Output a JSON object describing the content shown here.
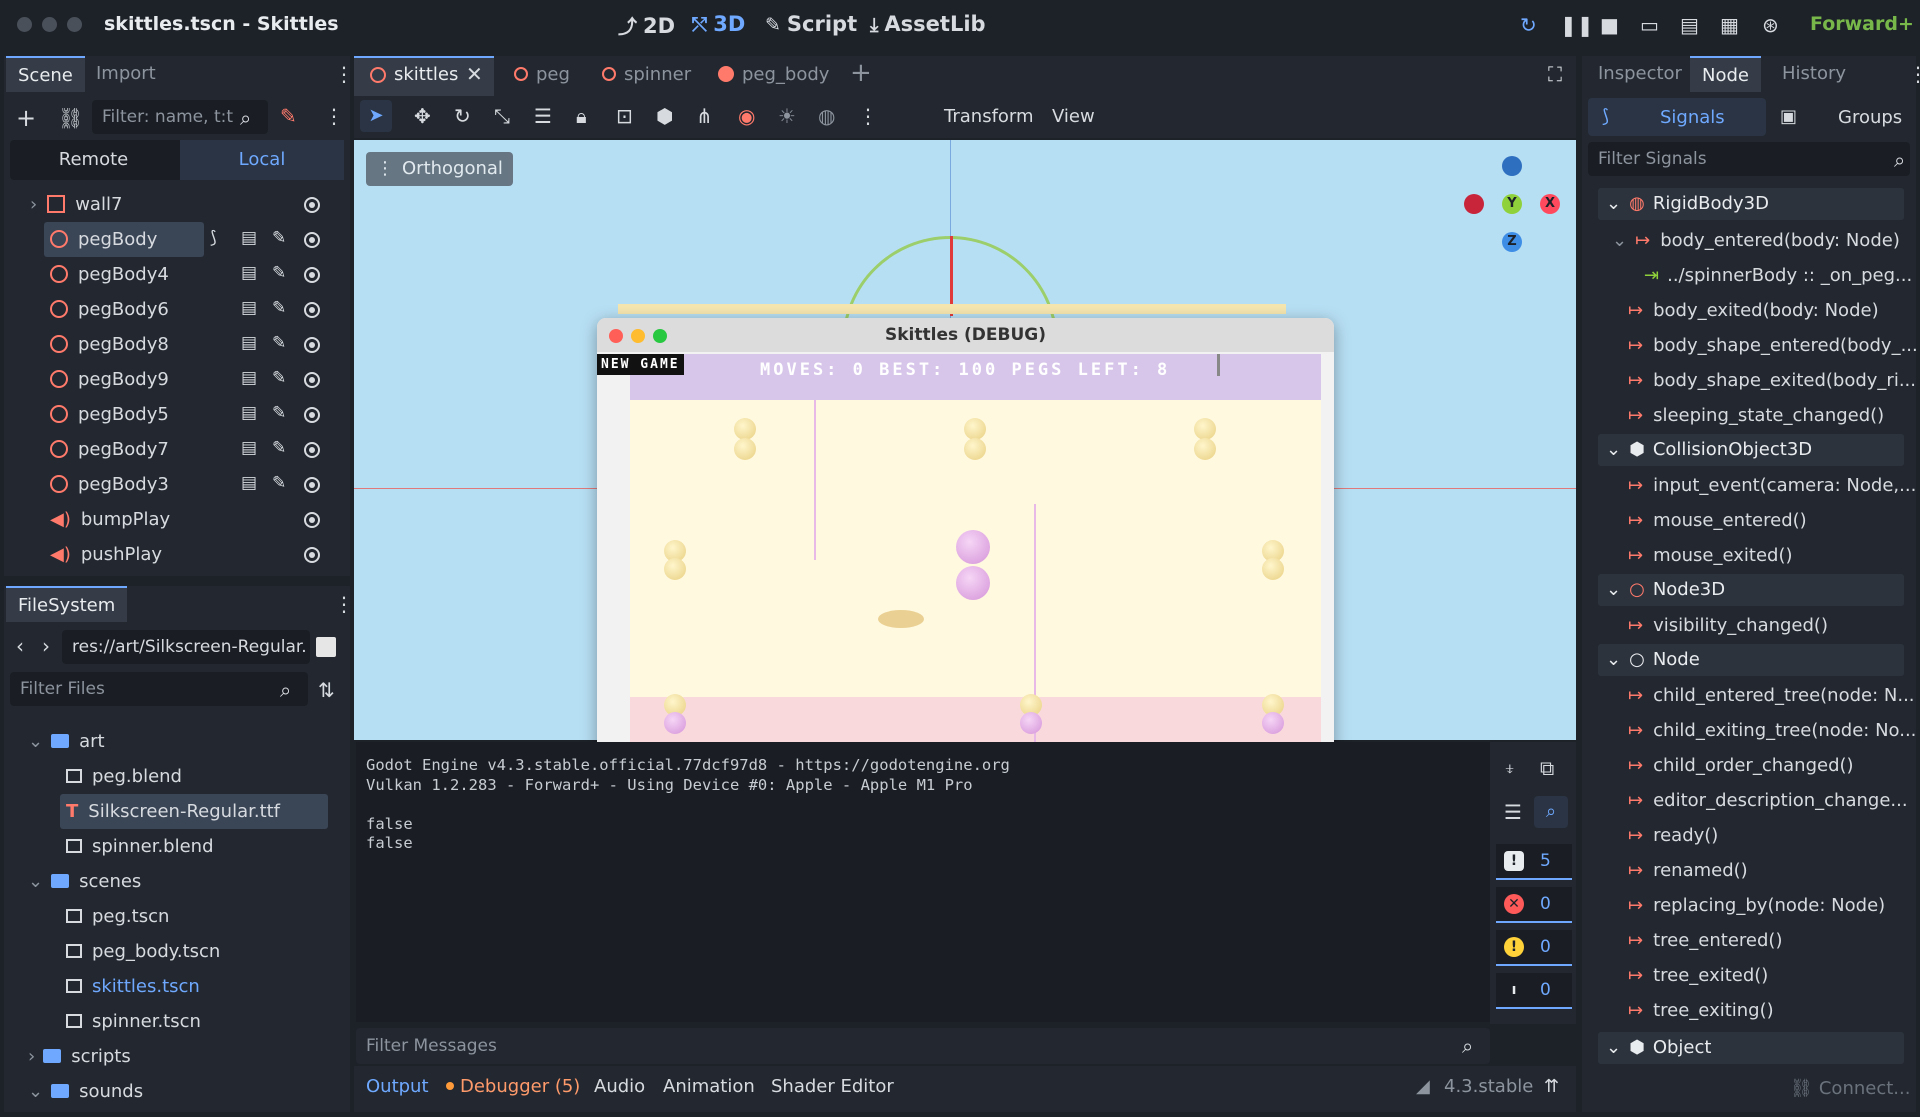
{
  "window": {
    "title": "skittles.tscn - Skittles",
    "renderer": "Forward+"
  },
  "modes": [
    {
      "label": "2D"
    },
    {
      "label": "3D"
    },
    {
      "label": "Script"
    },
    {
      "label": "AssetLib"
    }
  ],
  "scene_dock": {
    "tabs": [
      "Scene",
      "Import"
    ],
    "filter_placeholder": "Filter: name, t:t",
    "remote_label": "Remote",
    "local_label": "Local",
    "nodes": [
      {
        "name": "wall7",
        "type": "static"
      },
      {
        "name": "pegBody",
        "type": "rigid"
      },
      {
        "name": "pegBody4",
        "type": "rigid"
      },
      {
        "name": "pegBody6",
        "type": "rigid"
      },
      {
        "name": "pegBody8",
        "type": "rigid"
      },
      {
        "name": "pegBody9",
        "type": "rigid"
      },
      {
        "name": "pegBody5",
        "type": "rigid"
      },
      {
        "name": "pegBody7",
        "type": "rigid"
      },
      {
        "name": "pegBody3",
        "type": "rigid"
      },
      {
        "name": "bumpPlay",
        "type": "audio"
      },
      {
        "name": "pushPlay",
        "type": "audio"
      }
    ]
  },
  "filesystem": {
    "title": "FileSystem",
    "path": "res://art/Silkscreen-Regular.",
    "filter_placeholder": "Filter Files",
    "items": [
      {
        "name": "art",
        "kind": "folder"
      },
      {
        "name": "peg.blend",
        "kind": "file"
      },
      {
        "name": "Silkscreen-Regular.ttf",
        "kind": "font"
      },
      {
        "name": "spinner.blend",
        "kind": "file"
      },
      {
        "name": "scenes",
        "kind": "folder"
      },
      {
        "name": "peg.tscn",
        "kind": "file"
      },
      {
        "name": "peg_body.tscn",
        "kind": "file"
      },
      {
        "name": "skittles.tscn",
        "kind": "file"
      },
      {
        "name": "spinner.tscn",
        "kind": "file"
      },
      {
        "name": "scripts",
        "kind": "folder"
      },
      {
        "name": "sounds",
        "kind": "folder"
      }
    ]
  },
  "editor_tabs": [
    "skittles",
    "peg",
    "spinner",
    "peg_body"
  ],
  "viewport_toolbar": {
    "transform": "Transform",
    "view": "View",
    "projection": "Orthogonal"
  },
  "gizmo": {
    "x": "X",
    "y": "Y",
    "z": "Z"
  },
  "game_window": {
    "title": "Skittles (DEBUG)",
    "new_game": "NEW GAME",
    "hud": "MOVES: 0 BEST: 100 PEGS LEFT: 8"
  },
  "console": {
    "lines": [
      "Godot Engine v4.3.stable.official.77dcf97d8 - https://godotengine.org",
      "Vulkan 1.2.283 - Forward+ - Using Device #0: Apple - Apple M1 Pro",
      "",
      "false",
      "false"
    ],
    "filter_placeholder": "Filter Messages",
    "counts": {
      "messages": "5",
      "errors": "0",
      "warnings": "0",
      "info": "0"
    }
  },
  "bottom_tabs": {
    "output": "Output",
    "debugger": "Debugger (5)",
    "audio": "Audio",
    "animation": "Animation",
    "shader": "Shader Editor",
    "version": "4.3.stable"
  },
  "inspector": {
    "tabs": [
      "Inspector",
      "Node",
      "History"
    ],
    "signals_label": "Signals",
    "groups_label": "Groups",
    "filter_placeholder": "Filter Signals",
    "connect_label": "Connect...",
    "groups": [
      {
        "name": "RigidBody3D",
        "signals": [
          "body_entered(body: Node)",
          "../spinnerBody :: _on_peg...",
          "body_exited(body: Node)",
          "body_shape_entered(body_...",
          "body_shape_exited(body_ri...",
          "sleeping_state_changed()"
        ]
      },
      {
        "name": "CollisionObject3D",
        "signals": [
          "input_event(camera: Node,...",
          "mouse_entered()",
          "mouse_exited()"
        ]
      },
      {
        "name": "Node3D",
        "signals": [
          "visibility_changed()"
        ]
      },
      {
        "name": "Node",
        "signals": [
          "child_entered_tree(node: N...",
          "child_exiting_tree(node: No...",
          "child_order_changed()",
          "editor_description_change...",
          "ready()",
          "renamed()",
          "replacing_by(node: Node)",
          "tree_entered()",
          "tree_exited()",
          "tree_exiting()"
        ]
      },
      {
        "name": "Object",
        "signals": []
      }
    ]
  }
}
